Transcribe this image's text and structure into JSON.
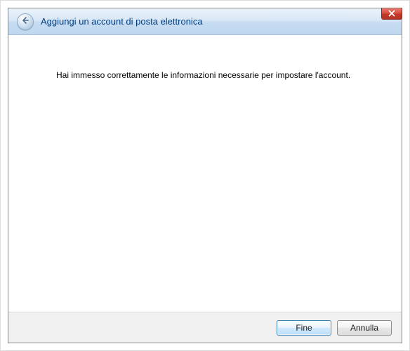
{
  "header": {
    "title": "Aggiungi un account di posta elettronica"
  },
  "content": {
    "message": "Hai immesso correttamente le informazioni necessarie per impostare l'account."
  },
  "footer": {
    "finish_label": "Fine",
    "cancel_label": "Annulla"
  }
}
